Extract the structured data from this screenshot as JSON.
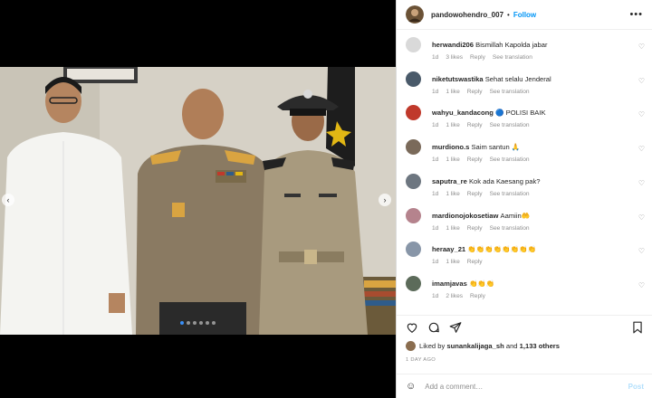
{
  "post": {
    "username": "pandowohendro_007",
    "separator": "•",
    "follow_label": "Follow",
    "more_icon": "more-horizontal-icon"
  },
  "comments": [
    {
      "user": "herwandi206",
      "text": "Bismillah Kapolda jabar",
      "age": "1d",
      "likes": "3 likes",
      "reply": "Reply",
      "translate": "See translation",
      "avatar_color": "#d9d9d9"
    },
    {
      "user": "niketutswastika",
      "text": "Sehat selalu Jenderal",
      "age": "1d",
      "likes": "1 like",
      "reply": "Reply",
      "translate": "See translation",
      "avatar_color": "#4a5a6a"
    },
    {
      "user": "wahyu_kandacong",
      "text": "🔵 POLISI BAIK",
      "age": "1d",
      "likes": "1 like",
      "reply": "Reply",
      "translate": "See translation",
      "avatar_color": "#c0392b"
    },
    {
      "user": "murdiono.s",
      "text": "Saim santun 🙏",
      "age": "1d",
      "likes": "1 like",
      "reply": "Reply",
      "translate": "See translation",
      "avatar_color": "#7a6a5a"
    },
    {
      "user": "saputra_re",
      "text": "Kok ada Kaesang pak?",
      "age": "1d",
      "likes": "1 like",
      "reply": "Reply",
      "translate": "See translation",
      "avatar_color": "#6d7680"
    },
    {
      "user": "mardionojokosetiaw",
      "text": "Aamiin🤲",
      "age": "1d",
      "likes": "1 like",
      "reply": "Reply",
      "translate": "See translation",
      "avatar_color": "#b5838d"
    },
    {
      "user": "heraay_21",
      "text": "👏👏👏👏👏👏👏👏",
      "age": "1d",
      "likes": "1 like",
      "reply": "Reply",
      "translate": "",
      "avatar_color": "#8896a8"
    },
    {
      "user": "imamjavas",
      "text": "👏👏👏",
      "age": "1d",
      "likes": "2 likes",
      "reply": "Reply",
      "translate": "",
      "avatar_color": "#5c6b5a"
    }
  ],
  "likes": {
    "prefix": "Liked by",
    "user": "sunankalijaga_sh",
    "middle": "and",
    "count": "1,133 others"
  },
  "time_ago": "1 DAY AGO",
  "add_comment": {
    "placeholder": "Add a comment…",
    "post_label": "Post"
  },
  "carousel": {
    "total": 6,
    "current": 1
  },
  "colors": {
    "accent": "#0095f6",
    "post_disabled": "#b2dffc"
  }
}
